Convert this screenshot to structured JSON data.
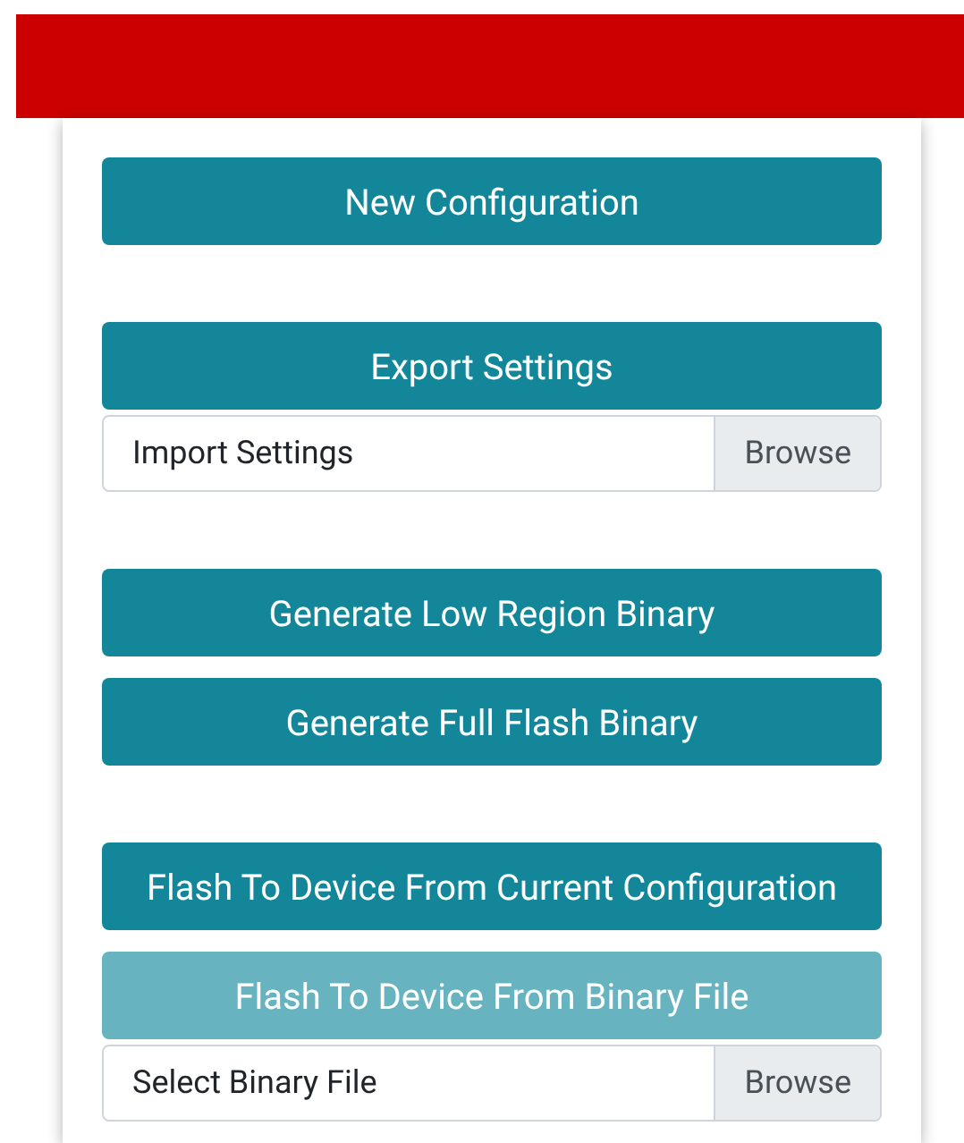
{
  "sections": [
    {
      "items": [
        {
          "kind": "button",
          "label": "New Configuration",
          "disabled": false
        }
      ]
    },
    {
      "items": [
        {
          "kind": "button",
          "label": "Export Settings",
          "disabled": false
        },
        {
          "kind": "file",
          "placeholder": "Import Settings",
          "browse": "Browse"
        }
      ]
    },
    {
      "items": [
        {
          "kind": "button",
          "label": "Generate Low Region Binary",
          "disabled": false
        },
        {
          "kind": "button",
          "label": "Generate Full Flash Binary",
          "disabled": false
        }
      ]
    },
    {
      "items": [
        {
          "kind": "button",
          "label": "Flash To Device From Current Configuration",
          "disabled": false
        },
        {
          "kind": "button",
          "label": "Flash To Device From Binary File",
          "disabled": true
        },
        {
          "kind": "file",
          "placeholder": "Select Binary File",
          "browse": "Browse"
        }
      ]
    }
  ]
}
